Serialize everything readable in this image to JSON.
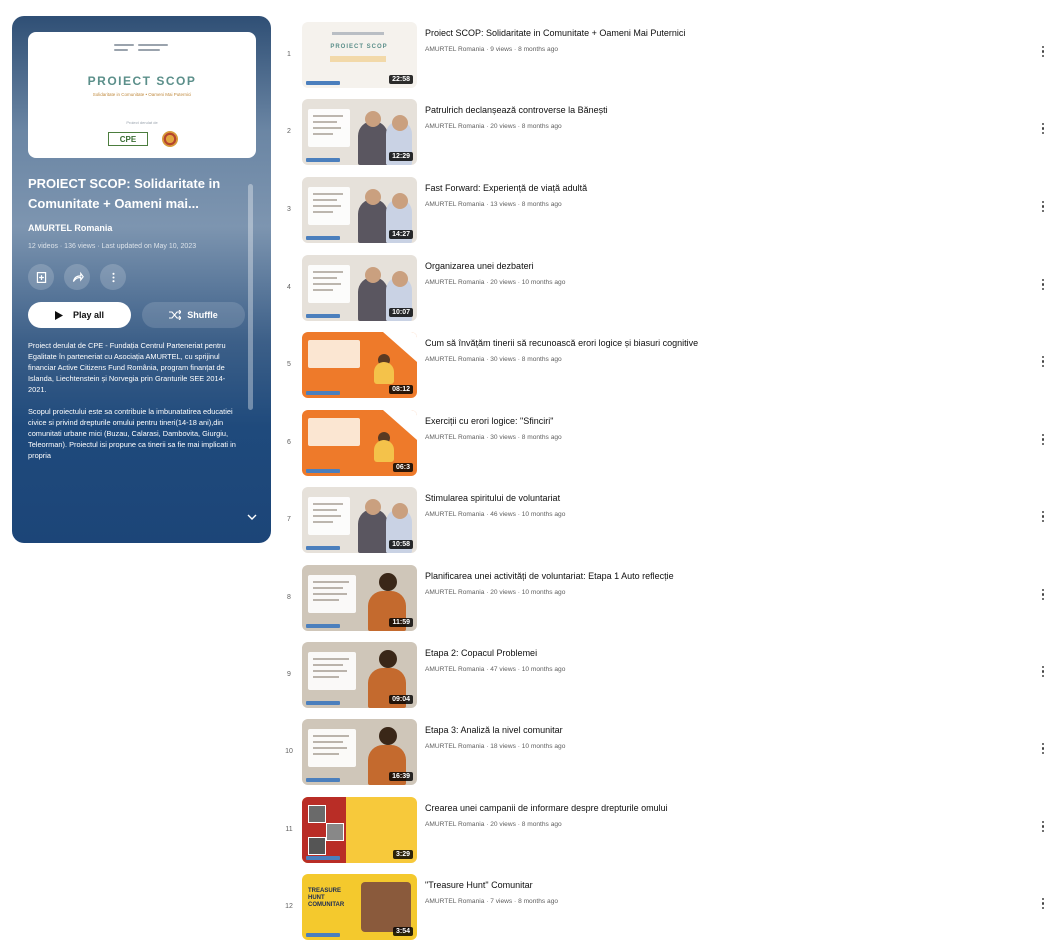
{
  "playlist": {
    "hero": {
      "title": "PROIECT SCOP",
      "subtitle": "Solidaritate in Comunitate • Oameni Mai Puternici",
      "funded_by": "Proiect derulat de",
      "partner_logo": "CPE"
    },
    "title": "PROIECT SCOP: Solidaritate in Comunitate + Oameni mai...",
    "owner": "AMURTEL Romania",
    "meta": "12 videos · 136 views · Last updated on May 10, 2023",
    "actions": {
      "save_icon": "save-to-library-icon",
      "share_icon": "share-icon",
      "more_icon": "more-vertical-icon"
    },
    "play_all_label": "Play all",
    "shuffle_label": "Shuffle",
    "description": [
      "Proiect derulat de CPE - Fundația Centrul Parteneriat pentru Egalitate în parteneriat cu Asociația AMURTEL, cu sprijinul financiar Active Citizens Fund România, program finanțat de Islanda, Liechtenstein și Norvegia prin Granturile SEE 2014-2021.",
      "Scopul proiectului este sa contribuie la imbunatatirea educatiei civice si privind drepturile omului pentru tineri(14-18 ani),din comunitati urbane mici (Buzau, Calarasi, Dambovita, Giurgiu, Teleorman). Proiectul isi propune ca tinerii sa fie mai implicati in propria"
    ]
  },
  "videos": [
    {
      "index": "1",
      "title": "Proiect SCOP: Solidaritate in Comunitate + Oameni Mai Puternici",
      "meta": "AMURTEL Romania · 9 views · 8 months ago",
      "duration": "22:58",
      "style": "white"
    },
    {
      "index": "2",
      "title": "Patrulrich declanșează controverse la Bănești",
      "meta": "AMURTEL Romania · 20 views · 8 months ago",
      "duration": "12:29",
      "style": "photo"
    },
    {
      "index": "3",
      "title": "Fast Forward: Experiență de viață adultă",
      "meta": "AMURTEL Romania · 13 views · 8 months ago",
      "duration": "14:27",
      "style": "photo"
    },
    {
      "index": "4",
      "title": "Organizarea unei dezbateri",
      "meta": "AMURTEL Romania · 20 views · 10 months ago",
      "duration": "10:07",
      "style": "photo"
    },
    {
      "index": "5",
      "title": "Cum să învățăm tinerii să recunoască erori logice și biasuri cognitive",
      "meta": "AMURTEL Romania · 30 views · 8 months ago",
      "duration": "08:12",
      "style": "orange"
    },
    {
      "index": "6",
      "title": "Exerciții cu erori logice: \"Sfinciri\"",
      "meta": "AMURTEL Romania · 30 views · 8 months ago",
      "duration": "06:3",
      "style": "orange"
    },
    {
      "index": "7",
      "title": "Stimularea spiritului de voluntariat",
      "meta": "AMURTEL Romania · 46 views · 10 months ago",
      "duration": "10:58",
      "style": "photo"
    },
    {
      "index": "8",
      "title": "Planificarea unei activități de voluntariat: Etapa 1 Auto reflecție",
      "meta": "AMURTEL Romania · 20 views · 10 months ago",
      "duration": "11:59",
      "style": "brown"
    },
    {
      "index": "9",
      "title": "Etapa 2: Copacul Problemei",
      "meta": "AMURTEL Romania · 47 views · 10 months ago",
      "duration": "09:04",
      "style": "brown"
    },
    {
      "index": "10",
      "title": "Etapa 3: Analiză la nivel comunitar",
      "meta": "AMURTEL Romania · 18 views · 10 months ago",
      "duration": "16:39",
      "style": "brown"
    },
    {
      "index": "11",
      "title": "Crearea unei campanii de informare despre drepturile omului",
      "meta": "AMURTEL Romania · 20 views · 8 months ago",
      "duration": "3:29",
      "style": "yellow"
    },
    {
      "index": "12",
      "title": "\"Treasure Hunt\" Comunitar",
      "meta": "AMURTEL Romania · 7 views · 8 months ago",
      "duration": "3:54",
      "style": "yellow2"
    }
  ]
}
